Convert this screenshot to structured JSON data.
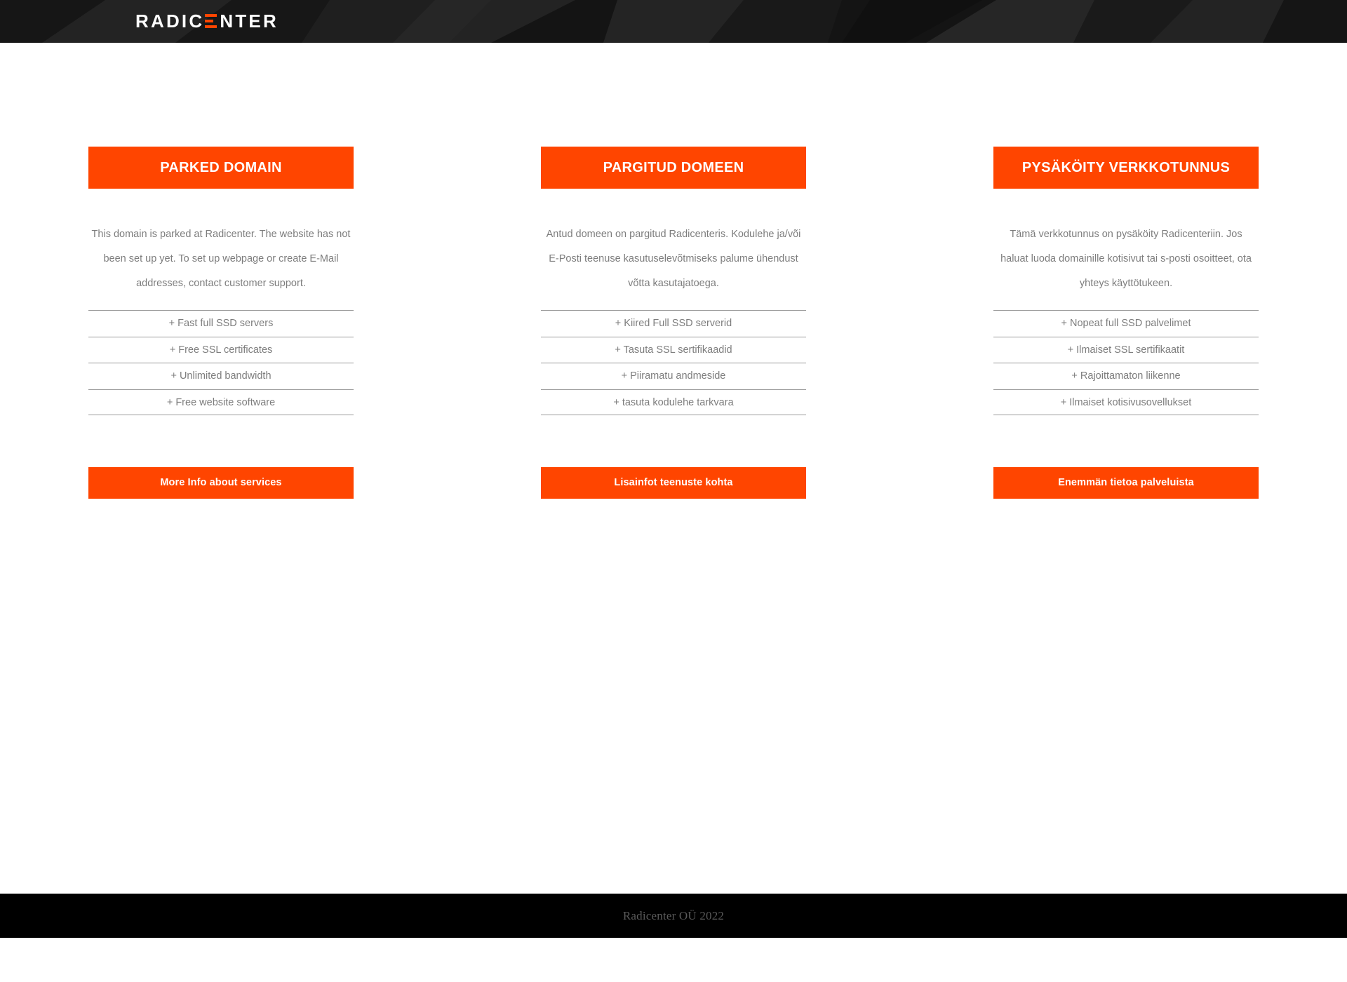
{
  "header": {
    "logo": {
      "name": "radicenter-logo",
      "text_before": "RADIC",
      "text_after": "NTER",
      "accent_letter": "E",
      "accent_color": "#ff4500",
      "text_color": "#ffffff"
    },
    "background_color": "#1b1b1b"
  },
  "theme": {
    "accent": "#ff4500",
    "body_text": "#7d7d7d",
    "divider": "#9a9a9a",
    "page_background": "#ffffff",
    "footer_background": "#000000",
    "footer_text": "#5a5a5a"
  },
  "cards": [
    {
      "lang": "en",
      "title": "PARKED DOMAIN",
      "description": "This domain is parked at Radicenter. The website has not been set up yet. To set up webpage or create E-Mail addresses, contact customer support.",
      "features": [
        "+ Fast full SSD servers",
        "+ Free SSL certificates",
        "+ Unlimited bandwidth",
        "+ Free website software"
      ],
      "cta_label": "More Info about services"
    },
    {
      "lang": "et",
      "title": "PARGITUD DOMEEN",
      "description": "Antud domeen on pargitud Radicenteris. Kodulehe ja/või E-Posti teenuse kasutuselevõtmiseks palume ühendust võtta kasutajatoega.",
      "features": [
        "+ Kiired Full SSD serverid",
        "+ Tasuta SSL sertifikaadid",
        "+ Piiramatu andmeside",
        "+ tasuta kodulehe tarkvara"
      ],
      "cta_label": "Lisainfot teenuste kohta"
    },
    {
      "lang": "fi",
      "title": "PYSÄKÖITY VERKKOTUNNUS",
      "description": "Tämä verkkotunnus on pysäköity Radicenteriin. Jos haluat luoda domainille kotisivut tai s-posti osoitteet, ota yhteys käyttötukeen.",
      "features": [
        "+ Nopeat full SSD palvelimet",
        "+ Ilmaiset SSL sertifikaatit",
        "+ Rajoittamaton liikenne",
        "+ Ilmaiset kotisivusovellukset"
      ],
      "cta_label": "Enemmän tietoa palveluista"
    }
  ],
  "footer": {
    "copyright": "Radicenter OÜ 2022"
  }
}
